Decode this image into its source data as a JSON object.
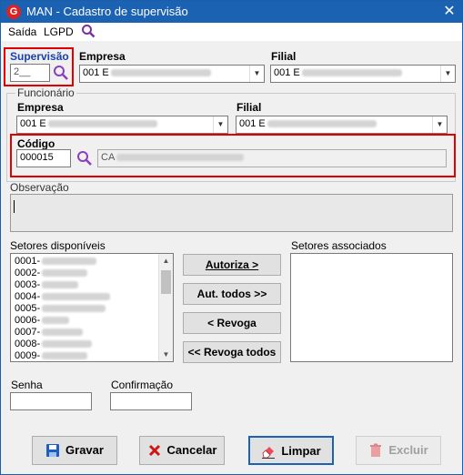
{
  "window": {
    "title": "MAN - Cadastro de supervisão",
    "app_icon": "G",
    "close": "✕"
  },
  "menu": {
    "items": [
      "Saída",
      "LGPD"
    ]
  },
  "supervisao": {
    "label": "Supervisão",
    "value": "2__"
  },
  "empresa": {
    "label": "Empresa",
    "value": "001 E"
  },
  "filial": {
    "label": "Filial",
    "value": "001 E"
  },
  "funcionario": {
    "group_label": "Funcionário",
    "empresa_label": "Empresa",
    "empresa_value": "001 E",
    "filial_label": "Filial",
    "filial_value": "001 E",
    "codigo_label": "Código",
    "codigo_value": "000015",
    "nome_value": "CA"
  },
  "observacao": {
    "label": "Observação"
  },
  "setores_disponiveis": {
    "label": "Setores disponíveis",
    "items": [
      "0001-",
      "0002-",
      "0003-",
      "0004-",
      "0005-",
      "0006-",
      "0007-",
      "0008-",
      "0009-"
    ]
  },
  "setores_associados": {
    "label": "Setores associados"
  },
  "actions": {
    "autoriza": "Autoriza >",
    "aut_todos": "Aut. todos >>",
    "revoga": "< Revoga",
    "revoga_todos": "<< Revoga todos"
  },
  "senha": {
    "label": "Senha"
  },
  "confirmacao": {
    "label": "Confirmação"
  },
  "footer": {
    "gravar": "Gravar",
    "cancelar": "Cancelar",
    "limpar": "Limpar",
    "excluir": "Excluir"
  },
  "colors": {
    "titlebar": "#1c62b3",
    "highlight": "#e10000",
    "search_icon": "#8a3fbf"
  }
}
